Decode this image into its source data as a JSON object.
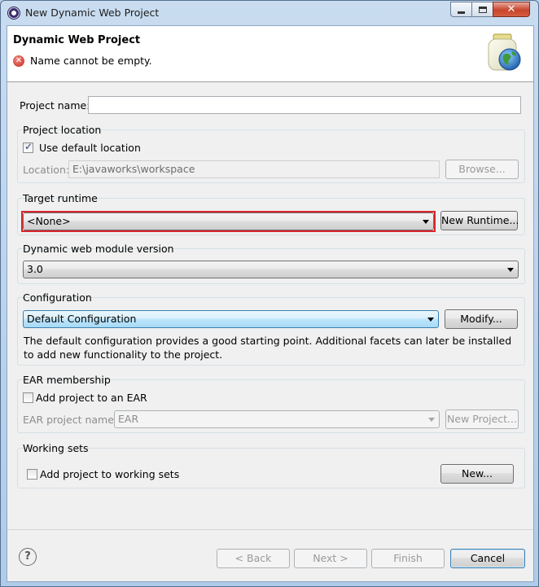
{
  "window": {
    "title": "New Dynamic Web Project",
    "controls": {
      "minimize_icon": "minimize-icon",
      "maximize_icon": "maximize-icon",
      "close_icon": "close-icon"
    }
  },
  "header": {
    "title": "Dynamic Web Project",
    "message": "Name cannot be empty.",
    "message_icon": "error-icon"
  },
  "project_name": {
    "label": "Project name:",
    "value": ""
  },
  "project_location": {
    "group_label": "Project location",
    "use_default_label": "Use default location",
    "use_default_checked": true,
    "location_label": "Location:",
    "location_value": "E:\\javaworks\\workspace",
    "browse_label": "Browse..."
  },
  "target_runtime": {
    "group_label": "Target runtime",
    "selected": "<None>",
    "new_runtime_label": "New Runtime..."
  },
  "module_version": {
    "group_label": "Dynamic web module version",
    "selected": "3.0"
  },
  "configuration": {
    "group_label": "Configuration",
    "selected": "Default Configuration",
    "modify_label": "Modify...",
    "description": "The default configuration provides a good starting point. Additional facets can later be installed to add new functionality to the project."
  },
  "ear": {
    "group_label": "EAR membership",
    "add_label": "Add project to an EAR",
    "add_checked": false,
    "name_label": "EAR project name:",
    "name_value": "EAR",
    "new_project_label": "New Project..."
  },
  "working_sets": {
    "group_label": "Working sets",
    "add_label": "Add project to working sets",
    "add_checked": false,
    "new_label": "New..."
  },
  "footer": {
    "help_icon": "help-icon",
    "back_label": "< Back",
    "next_label": "Next >",
    "finish_label": "Finish",
    "cancel_label": "Cancel"
  },
  "colors": {
    "highlight_border": "#d9252a",
    "error_red": "#c8261a",
    "dialog_bg": "#f0f0f0",
    "selection_blue": "#bee6fd"
  }
}
